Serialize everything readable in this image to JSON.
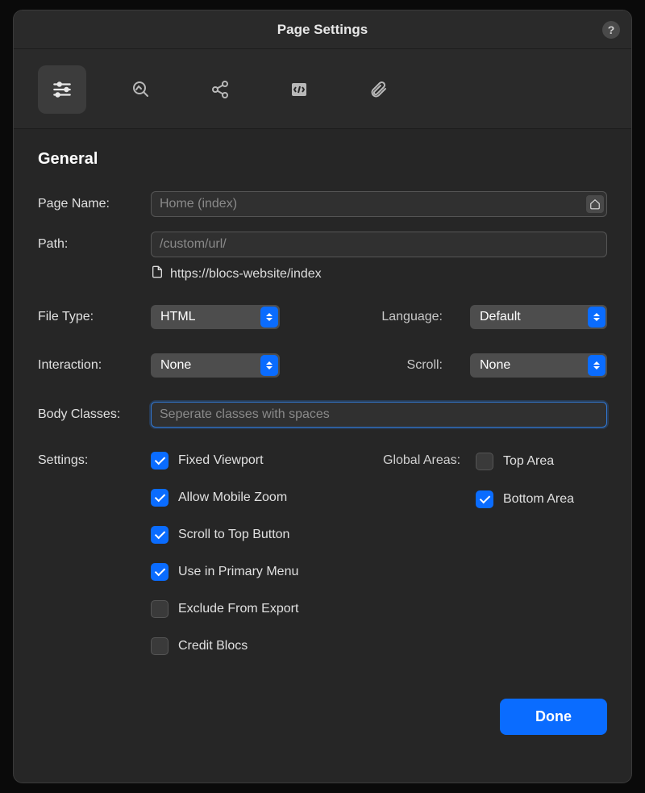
{
  "title": "Page Settings",
  "section": "General",
  "labels": {
    "pageName": "Page Name:",
    "path": "Path:",
    "fileType": "File Type:",
    "language": "Language:",
    "interaction": "Interaction:",
    "scroll": "Scroll:",
    "bodyClasses": "Body Classes:",
    "settings": "Settings:",
    "globalAreas": "Global Areas:"
  },
  "placeholders": {
    "pageName": "Home (index)",
    "path": "/custom/url/",
    "bodyClasses": "Seperate classes with spaces"
  },
  "urlPreview": "https://blocs-website/index",
  "selects": {
    "fileType": "HTML",
    "language": "Default",
    "interaction": "None",
    "scroll": "None"
  },
  "checks": {
    "fixedViewport": {
      "label": "Fixed Viewport",
      "checked": true
    },
    "allowMobileZoom": {
      "label": "Allow Mobile Zoom",
      "checked": true
    },
    "scrollToTop": {
      "label": "Scroll to Top Button",
      "checked": true
    },
    "useInPrimaryMenu": {
      "label": "Use in Primary Menu",
      "checked": true
    },
    "excludeFromExport": {
      "label": "Exclude From Export",
      "checked": false
    },
    "creditBlocs": {
      "label": "Credit Blocs",
      "checked": false
    },
    "topArea": {
      "label": "Top Area",
      "checked": false
    },
    "bottomArea": {
      "label": "Bottom Area",
      "checked": true
    }
  },
  "buttons": {
    "done": "Done",
    "help": "?"
  }
}
